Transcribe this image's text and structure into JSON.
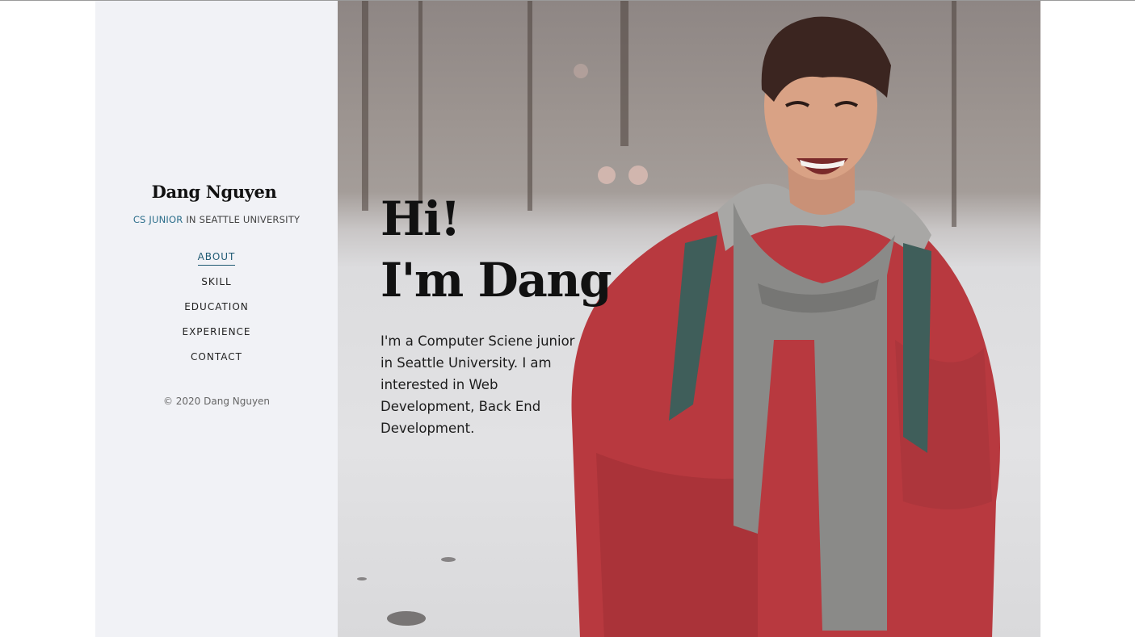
{
  "sidebar": {
    "name": "Dang Nguyen",
    "subtitle_highlight": "CS JUNIOR",
    "subtitle_rest": " IN SEATTLE UNIVERSITY",
    "nav": [
      {
        "label": "ABOUT",
        "active": true
      },
      {
        "label": "SKILL",
        "active": false
      },
      {
        "label": "EDUCATION",
        "active": false
      },
      {
        "label": "EXPERIENCE",
        "active": false
      },
      {
        "label": "CONTACT",
        "active": false
      }
    ],
    "copyright": "© 2020 Dang Nguyen"
  },
  "hero": {
    "line1": "Hi!",
    "line2": "I'm Dang",
    "intro": "I'm a Computer Sciene junior in Seattle University. I am interested in Web Development, Back End Development."
  },
  "colors": {
    "accent": "#1f5a73",
    "sidebar_bg": "#f1f2f6",
    "jacket": "#b8393f",
    "scarf": "#8a8a88"
  }
}
